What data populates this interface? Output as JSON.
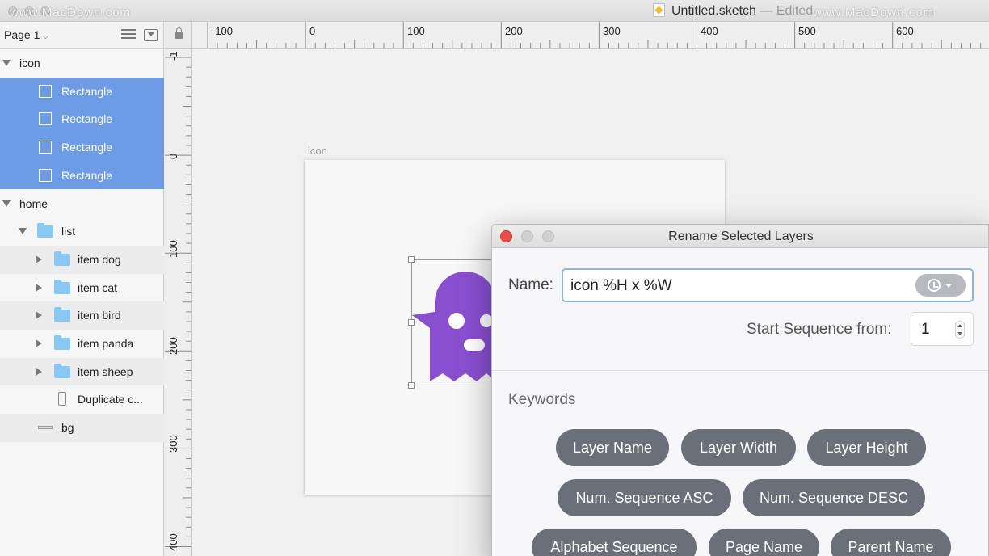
{
  "window": {
    "title": "Untitled.sketch",
    "title_suffix": " — Edited",
    "watermark": "www.MacDown.com"
  },
  "sidebar": {
    "page_selector": "Page 1",
    "layers": [
      {
        "label": "icon",
        "kind": "group",
        "expanded": true,
        "selected": false
      },
      {
        "label": "Rectangle",
        "kind": "rectangle",
        "selected": true
      },
      {
        "label": "Rectangle",
        "kind": "rectangle",
        "selected": true
      },
      {
        "label": "Rectangle",
        "kind": "rectangle",
        "selected": true
      },
      {
        "label": "Rectangle",
        "kind": "rectangle",
        "selected": true
      },
      {
        "label": "home",
        "kind": "group",
        "expanded": true,
        "selected": false
      },
      {
        "label": "list",
        "kind": "folder",
        "expanded": true,
        "selected": false
      },
      {
        "label": "item dog",
        "kind": "folder",
        "expanded": false,
        "selected": false
      },
      {
        "label": "item cat",
        "kind": "folder",
        "expanded": false,
        "selected": false
      },
      {
        "label": "item bird",
        "kind": "folder",
        "expanded": false,
        "selected": false
      },
      {
        "label": "item panda",
        "kind": "folder",
        "expanded": false,
        "selected": false
      },
      {
        "label": "item sheep",
        "kind": "folder",
        "expanded": false,
        "selected": false
      },
      {
        "label": "Duplicate c...",
        "kind": "symbol",
        "selected": false
      },
      {
        "label": "bg",
        "kind": "shape",
        "selected": false
      }
    ]
  },
  "rulers": {
    "horizontal": [
      "-100",
      "0",
      "100",
      "200",
      "300",
      "400",
      "500",
      "600"
    ],
    "vertical": [
      "-1",
      "0",
      "100",
      "200",
      "300",
      "400"
    ]
  },
  "canvas": {
    "artboard_label": "icon",
    "icon_color": "#8a4fd1"
  },
  "dialog": {
    "title": "Rename Selected Layers",
    "name_label": "Name:",
    "name_value": "icon %H x %W",
    "sequence_label": "Start Sequence from:",
    "sequence_value": "1",
    "keywords_label": "Keywords",
    "keywords": [
      "Layer Name",
      "Layer Width",
      "Layer Height",
      "Num. Sequence ASC",
      "Num. Sequence DESC",
      "Alphabet Sequence",
      "Page Name",
      "Parent Name"
    ]
  },
  "colors": {
    "selection": "#6d9be6",
    "chip": "#6b6f7a",
    "close": "#ee4b46"
  }
}
